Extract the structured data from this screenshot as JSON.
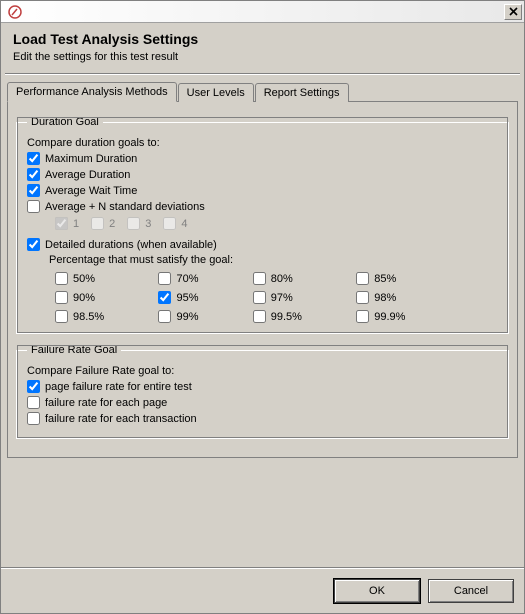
{
  "window": {
    "title_h1": "Load Test Analysis Settings",
    "subtitle": "Edit the settings for this test result"
  },
  "tabs": {
    "t0": "Performance Analysis Methods",
    "t1": "User Levels",
    "t2": "Report Settings"
  },
  "duration": {
    "legend": "Duration Goal",
    "compare_label": "Compare duration goals to:",
    "max_dur": "Maximum Duration",
    "avg_dur": "Average Duration",
    "avg_wait": "Average Wait Time",
    "avg_nstd": "Average + N standard deviations",
    "std1": "1",
    "std2": "2",
    "std3": "3",
    "std4": "4",
    "detailed": "Detailed durations (when available)",
    "pct_label": "Percentage that must satisfy the goal:",
    "p50": "50%",
    "p70": "70%",
    "p80": "80%",
    "p85": "85%",
    "p90": "90%",
    "p95": "95%",
    "p97": "97%",
    "p98": "98%",
    "p985": "98.5%",
    "p99": "99%",
    "p995": "99.5%",
    "p999": "99.9%"
  },
  "failure": {
    "legend": "Failure Rate Goal",
    "compare_label": "Compare Failure Rate goal to:",
    "entire": "page failure rate for entire test",
    "each_page": "failure rate for each page",
    "each_txn": "failure rate for each transaction"
  },
  "buttons": {
    "ok": "OK",
    "cancel": "Cancel"
  },
  "checked": {
    "max_dur": true,
    "avg_dur": true,
    "avg_wait": true,
    "avg_nstd": false,
    "std1": true,
    "detailed": true,
    "p95": true,
    "entire": true
  }
}
